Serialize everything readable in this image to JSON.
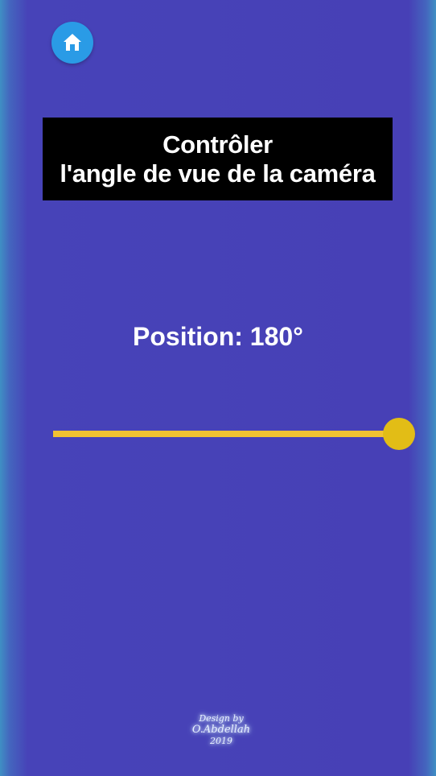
{
  "header": {
    "home_button": {
      "icon": "home-icon",
      "color": "#2a9be6"
    }
  },
  "title": {
    "line1": "Contrôler",
    "line2": "l'angle de vue de la caméra"
  },
  "position": {
    "label": "Position: 180°",
    "value_degrees": 180,
    "min_degrees": 0,
    "max_degrees": 180
  },
  "slider": {
    "track_color": "#f1c232",
    "thumb_color": "#e2bd16"
  },
  "footer": {
    "signature_line1": "Design by",
    "signature_line2": "O.Abdellah",
    "signature_line3": "2019"
  },
  "colors": {
    "background": "#4740b6",
    "edge": "#3f8fc4",
    "title_background": "#000000",
    "text": "#ffffff"
  }
}
